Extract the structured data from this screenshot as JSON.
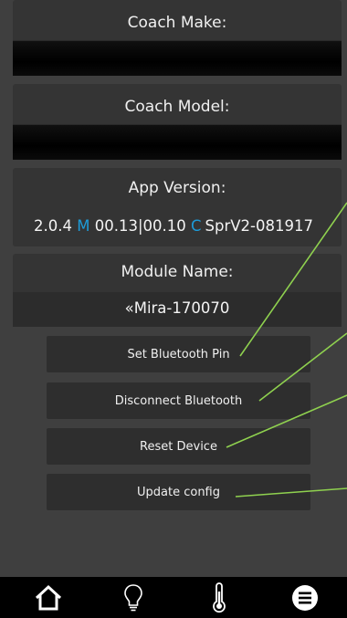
{
  "sections": {
    "coach_make": {
      "label": "Coach Make:",
      "value": ""
    },
    "coach_model": {
      "label": "Coach Model:",
      "value": ""
    },
    "app_version": {
      "label": "App Version:",
      "version": "2.0.4",
      "m_tag": "M",
      "m_value": "00.13|00.10",
      "c_tag": "C",
      "c_value": "SprV2-081917"
    },
    "module_name": {
      "label": "Module Name:",
      "value": "«Mira-170070"
    }
  },
  "buttons": {
    "set_pin": "Set Bluetooth Pin",
    "disconnect": "Disconnect Bluetooth",
    "reset": "Reset Device",
    "update": "Update config"
  },
  "nav": {
    "items": [
      "home-icon",
      "lightbulb-icon",
      "thermometer-icon",
      "menu-icon"
    ]
  },
  "colors": {
    "accent": "#1d9bd8",
    "annotation_line": "#8fd14f",
    "background": "#3f3f3f"
  }
}
